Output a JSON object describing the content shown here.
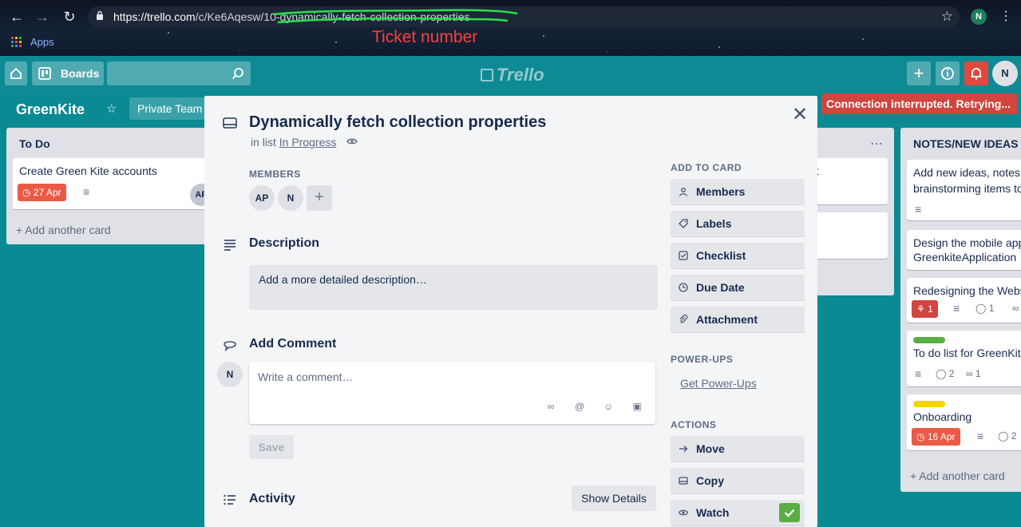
{
  "browser": {
    "url_host": "https://trello.com",
    "url_path": "/c/Ke6Aqesw/10-dynamically-fetch-collection-properties",
    "annotation": "Ticket number",
    "profile_initial": "N",
    "bookmark_apps": "Apps"
  },
  "header": {
    "boards_label": "Boards",
    "logo": "Trello",
    "user_initial": "N"
  },
  "board": {
    "name": "GreenKite",
    "team": "Private Team",
    "connection_banner": "Connection interrupted. Retrying..."
  },
  "lists": {
    "todo": {
      "title": "To Do",
      "card1_text": "Create Green Kite accounts",
      "card1_due": "27 Apr",
      "card1_member": "AP",
      "add_card": "+ Add another card"
    },
    "middle": {
      "card1_fragment": "nt"
    },
    "notes": {
      "title": "NOTES/NEW IDEAS",
      "card1_line1": "Add new ideas, notes",
      "card1_line2": "brainstorming items to",
      "card2_line1": "Design the mobile app",
      "card2_line2": "GreenkiteApplication",
      "card3_text": "Redesigning the Website",
      "card3_notif": "1",
      "card3_comments": "1",
      "card4_text": "To do list for GreenKite",
      "card4_comments": "2",
      "card4_attach": "1",
      "card5_text": "Onboarding",
      "card5_due": "16 Apr",
      "card5_comments": "2",
      "add_card": "+ Add another card"
    }
  },
  "modal": {
    "title": "Dynamically fetch collection properties",
    "in_list_prefix": "in list",
    "in_list_name": "In Progress",
    "members_heading": "MEMBERS",
    "members": [
      "AP",
      "N"
    ],
    "add_member": "+",
    "description_heading": "Description",
    "description_placeholder": "Add a more detailed description…",
    "add_comment_heading": "Add Comment",
    "comment_avatar": "N",
    "comment_placeholder": "Write a comment…",
    "save_label": "Save",
    "activity_heading": "Activity",
    "show_details_label": "Show Details",
    "add_to_card_heading": "ADD TO CARD",
    "add_to_card": [
      "Members",
      "Labels",
      "Checklist",
      "Due Date",
      "Attachment"
    ],
    "powerups_heading": "POWER-UPS",
    "get_powerups": "Get Power-Ups",
    "actions_heading": "ACTIONS",
    "actions": [
      "Move",
      "Copy",
      "Watch"
    ],
    "watching": true
  },
  "colors": {
    "board_bg": "#0a8a93",
    "due_red": "#eb5a46",
    "label_green": "#5aac44",
    "label_yellow": "#f2d600",
    "banner_red": "#d0453e"
  }
}
